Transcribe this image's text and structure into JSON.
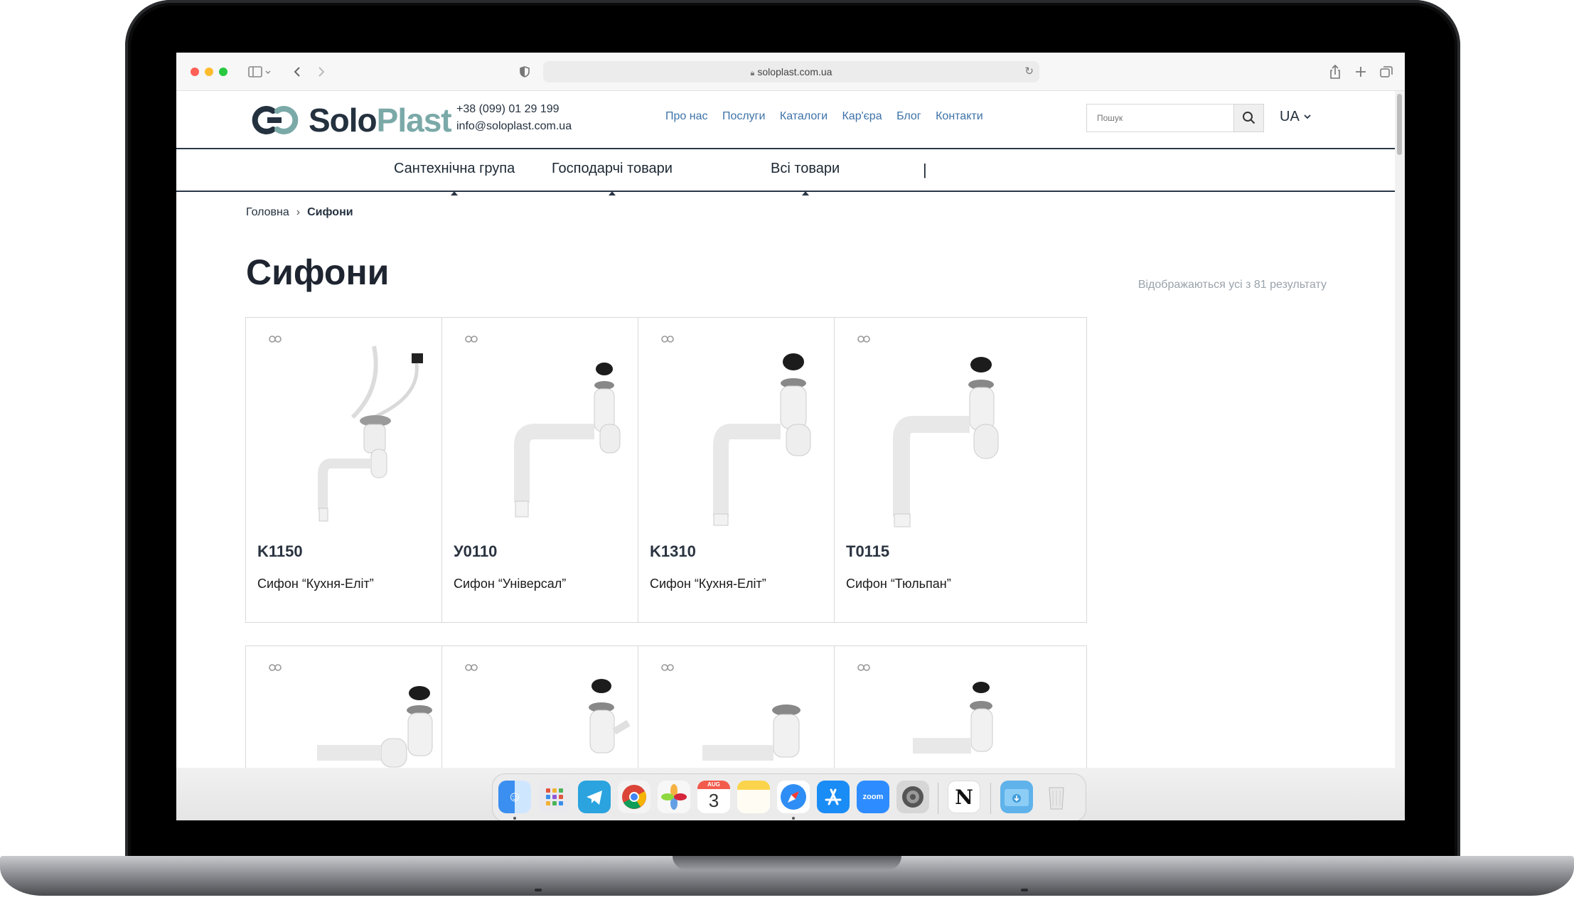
{
  "browser": {
    "url": "soloplast.com.ua"
  },
  "site": {
    "logo_solo": "Solo",
    "logo_plast": "Plast",
    "phone": "+38 (099) 01 29 199",
    "email": "info@soloplast.com.ua",
    "nav": [
      "Про нас",
      "Послуги",
      "Каталоги",
      "Кар'єра",
      "Блог",
      "Контакти"
    ],
    "search_placeholder": "Пошук",
    "lang": "UA",
    "categories": [
      "Сантехнічна група",
      "Господарчі товари",
      "Всі товари"
    ],
    "category_separator": "|"
  },
  "breadcrumb": {
    "home": "Головна",
    "current": "Сифони"
  },
  "page": {
    "title": "Сифони",
    "results": "Відображаються усі з 81 результату"
  },
  "products": [
    {
      "code": "K1150",
      "name": "Сифон “Кухня-Еліт”"
    },
    {
      "code": "У0110",
      "name": "Сифон “Універсал”"
    },
    {
      "code": "K1310",
      "name": "Сифон “Кухня-Еліт”"
    },
    {
      "code": "T0115",
      "name": "Сифон “Тюльпан”"
    }
  ],
  "dock": {
    "calendar_month": "AUG",
    "calendar_day": "3",
    "zoom_label": "zoom"
  },
  "colors": {
    "brand_dark": "#24313f",
    "brand_teal": "#7aa9a8",
    "link": "#3d72a8"
  }
}
